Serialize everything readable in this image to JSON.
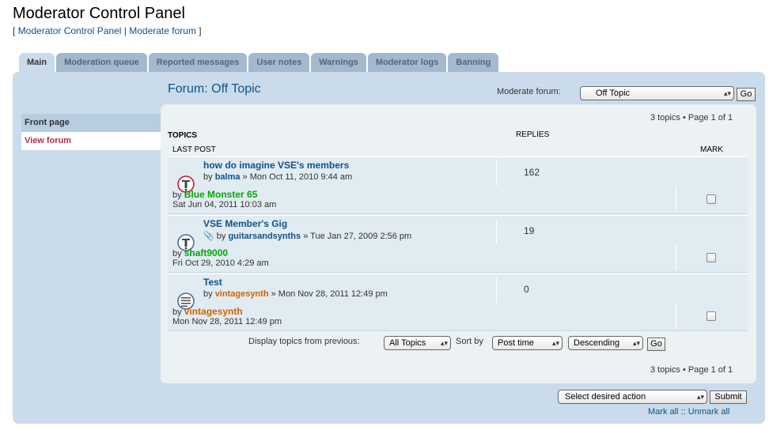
{
  "header": {
    "title": "Moderator Control Panel",
    "crumb_open": "[",
    "crumb_1": "Moderator Control Panel",
    "crumb_sep": "|",
    "crumb_2": "Moderate forum",
    "crumb_close": "]"
  },
  "tabs": [
    "Main",
    "Moderation queue",
    "Reported messages",
    "User notes",
    "Warnings",
    "Moderator logs",
    "Banning"
  ],
  "sidebar": {
    "head": "Front page",
    "current": "View forum"
  },
  "forum": {
    "title": "Forum: Off Topic",
    "moderate_label": "Moderate forum:",
    "moderate_value": "Off Topic",
    "go": "Go"
  },
  "pagination": {
    "top": "3 topics • Page 1 of 1",
    "bottom": "3 topics • Page 1 of 1"
  },
  "columns": {
    "topics": "TOPICS",
    "replies": "REPLIES",
    "last_post": "LAST POST",
    "mark": "MARK"
  },
  "topics": [
    {
      "title": "how do imagine VSE's members",
      "by_prefix": "by",
      "author": "balma",
      "date": "» Mon Oct 11, 2010 9:44 am",
      "replies": "162",
      "lp_prefix": "by",
      "lp_author": "Blue Monster 65",
      "lp_time": "Sat Jun 04, 2011 10:03 am"
    },
    {
      "title": "VSE Member's Gig",
      "by_prefix": "by",
      "author": "guitarsandsynths",
      "date": "» Tue Jan 27, 2009 2:56 pm",
      "replies": "19",
      "lp_prefix": "by",
      "lp_author": "shaft9000",
      "lp_time": "Fri Oct 29, 2010 4:29 am"
    },
    {
      "title": "Test",
      "by_prefix": "by",
      "author": "vintagesynth",
      "date": "» Mon Nov 28, 2011 12:49 pm",
      "replies": "0",
      "lp_prefix": "by",
      "lp_author": "vintagesynth",
      "lp_time": "Mon Nov 28, 2011 12:49 pm"
    }
  ],
  "display": {
    "label": "Display topics from previous:",
    "period": "All Topics",
    "sort_label": "Sort by",
    "sort_key": "Post time",
    "sort_dir": "Descending",
    "go": "Go"
  },
  "action": {
    "select": "Select desired action",
    "submit": "Submit",
    "mark_all": "Mark all",
    "sep": "::",
    "unmark_all": "Unmark all"
  },
  "colors": {
    "link": "#105289",
    "panel": "#cadceb",
    "active_sidebar": "#bc2a4d",
    "green_user": "#00aa00",
    "orange_user": "#cc6600"
  }
}
